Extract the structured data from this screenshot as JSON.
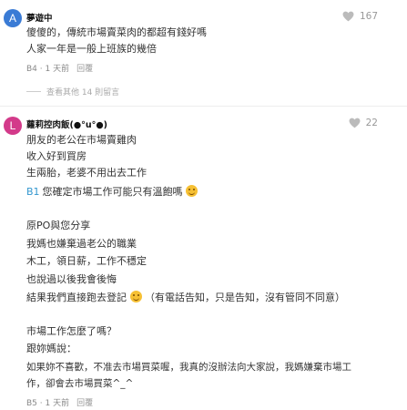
{
  "comments": [
    {
      "avatar_letter": "A",
      "avatar_color": "#3a7bd5",
      "author": "夢遊中",
      "likes": "167",
      "lines": [
        "傻傻的，傳統市場賣菜肉的都超有錢好嗎",
        "人家一年是一般上班族的幾倍"
      ],
      "floor": "B4",
      "time": "1 天前",
      "reply_label": "回覆",
      "more_replies": "查看其他 14 則留言"
    },
    {
      "avatar_letter": "L",
      "avatar_color": "#d33a8a",
      "author": "蘿莉控肉飯(●°u°●)",
      "likes": "22",
      "lines": [
        "朋友的老公在市場賣雞肉",
        "收入好到買房",
        "生兩胎，老婆不用出去工作",
        "您確定市場工作可能只有溫飽嗎",
        "",
        "原PO與您分享",
        "我媽也嫌棄過老公的職業",
        "木工，領日薪，工作不穩定",
        "也說過以後我會後悔",
        "結果我們直接跑去登記",
        "",
        "市場工作怎麼了嗎？",
        "跟妳媽說：",
        "如果妳不喜歡，不准去市場買菜喔，我真的沒辦法向大家說，我媽嫌棄市場工",
        "作，卻會去市場買菜^_^"
      ],
      "line3_ref": "B1",
      "line9_suffix": "（有電話告知，只是告知，沒有管同不同意）",
      "floor": "B5",
      "time": "1 天前",
      "reply_label": "回覆"
    }
  ],
  "icons": {
    "like": "heart-icon",
    "emoji": "smile-emoji-icon"
  },
  "colors": {
    "link": "#3397cf",
    "heart": "#bbbbbb"
  }
}
